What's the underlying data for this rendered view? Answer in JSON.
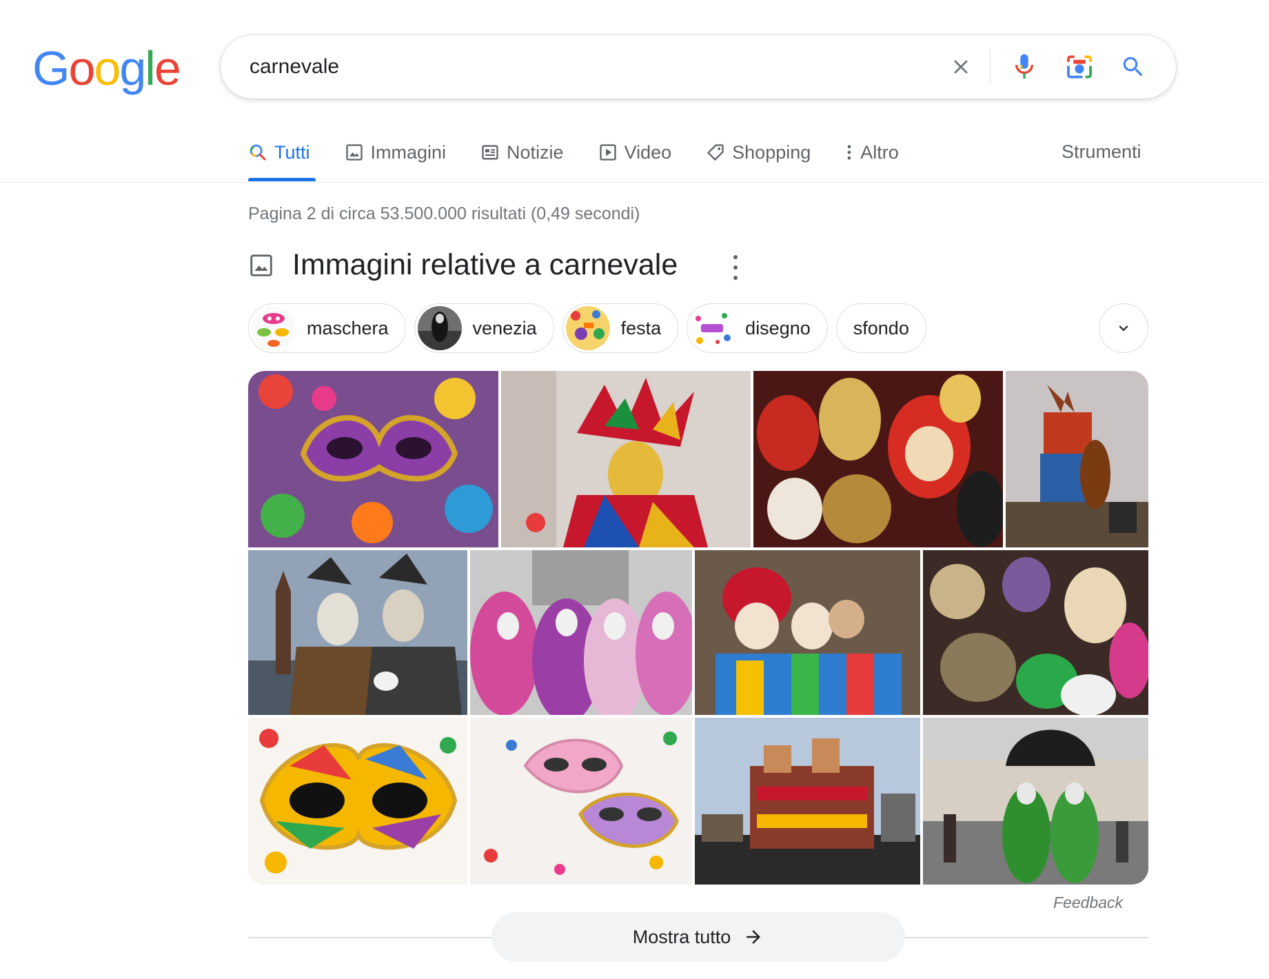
{
  "logo": {
    "letters": [
      "G",
      "o",
      "o",
      "g",
      "l",
      "e"
    ],
    "colors": [
      "#4285F4",
      "#EA4335",
      "#FBBC05",
      "#4285F4",
      "#34A853",
      "#EA4335"
    ]
  },
  "search": {
    "query": "carnevale",
    "placeholder": ""
  },
  "tabs": [
    {
      "label": "Tutti",
      "icon": "search-icon",
      "active": true
    },
    {
      "label": "Immagini",
      "icon": "image-icon",
      "active": false
    },
    {
      "label": "Notizie",
      "icon": "news-icon",
      "active": false
    },
    {
      "label": "Video",
      "icon": "play-icon",
      "active": false
    },
    {
      "label": "Shopping",
      "icon": "tag-icon",
      "active": false
    },
    {
      "label": "Altro",
      "icon": "more-vertical-icon",
      "active": false
    }
  ],
  "tools_label": "Strumenti",
  "result_stats": "Pagina 2 di circa 53.500.000 risultati (0,49 secondi)",
  "images_block": {
    "heading": "Immagini relative a carnevale",
    "chips": [
      {
        "label": "maschera",
        "thumb": "mask-thumb"
      },
      {
        "label": "venezia",
        "thumb": "venice-thumb"
      },
      {
        "label": "festa",
        "thumb": "party-thumb"
      },
      {
        "label": "disegno",
        "thumb": "drawing-thumb"
      },
      {
        "label": "sfondo",
        "thumb": ""
      }
    ],
    "feedback": "Feedback",
    "show_all": "Mostra tutto"
  },
  "colors": {
    "accent": "#1a73e8",
    "muted": "#5f6368",
    "stats": "#70757a",
    "chip_border": "#dadce0",
    "button_bg": "#f1f3f4"
  }
}
